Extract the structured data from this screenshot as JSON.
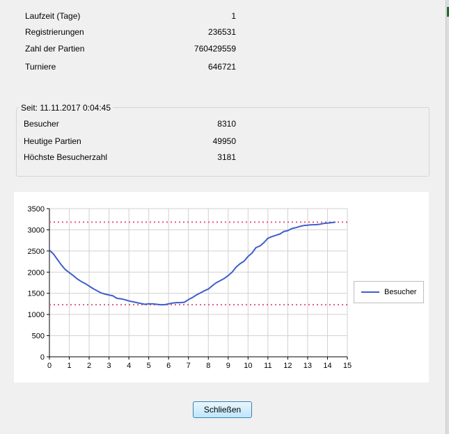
{
  "stats": [
    {
      "label": "Laufzeit (Tage)",
      "value": "1"
    },
    {
      "label": "Registrierungen",
      "value": "236531"
    },
    {
      "label": "Zahl der Partien",
      "value": "760429559"
    },
    {
      "label": "Turniere",
      "value": "646721"
    }
  ],
  "group": {
    "title": "Seit: 11.11.2017 0:04:45",
    "rows": [
      {
        "label": "Besucher",
        "value": "8310"
      },
      {
        "label": "Heutige Partien",
        "value": "49950"
      },
      {
        "label": "Höchste Besucherzahl",
        "value": "3181"
      }
    ]
  },
  "chart_data": {
    "type": "line",
    "xlim": [
      0,
      15
    ],
    "ylim": [
      0,
      3500
    ],
    "x_ticks": [
      "0",
      "1",
      "2",
      "3",
      "4",
      "5",
      "6",
      "7",
      "8",
      "9",
      "10",
      "11",
      "12",
      "13",
      "14",
      "15"
    ],
    "y_ticks": [
      "0",
      "500",
      "1000",
      "1500",
      "2000",
      "2500",
      "3000",
      "3500"
    ],
    "grid": true,
    "legend_position": "right",
    "series": [
      {
        "name": "Besucher",
        "color": "#3f5ecc",
        "x": [
          0,
          0.2,
          0.4,
          0.6,
          0.8,
          1.0,
          1.2,
          1.4,
          1.6,
          1.8,
          2.0,
          2.2,
          2.4,
          2.6,
          2.8,
          3.0,
          3.2,
          3.4,
          3.6,
          3.8,
          4.0,
          4.2,
          4.4,
          4.6,
          4.8,
          5.0,
          5.2,
          5.4,
          5.6,
          5.8,
          6.0,
          6.2,
          6.4,
          6.6,
          6.8,
          7.0,
          7.2,
          7.4,
          7.6,
          7.8,
          8.0,
          8.2,
          8.4,
          8.6,
          8.8,
          9.0,
          9.2,
          9.4,
          9.6,
          9.8,
          10.0,
          10.2,
          10.4,
          10.6,
          10.8,
          11.0,
          11.2,
          11.4,
          11.6,
          11.8,
          12.0,
          12.2,
          12.4,
          12.6,
          12.8,
          13.0,
          13.2,
          13.4,
          13.6,
          13.8,
          14.0,
          14.2,
          14.4
        ],
        "y": [
          2520,
          2430,
          2300,
          2170,
          2060,
          1990,
          1920,
          1840,
          1780,
          1730,
          1670,
          1610,
          1560,
          1510,
          1480,
          1460,
          1440,
          1380,
          1370,
          1350,
          1320,
          1300,
          1280,
          1260,
          1240,
          1250,
          1250,
          1240,
          1230,
          1230,
          1250,
          1270,
          1280,
          1280,
          1290,
          1350,
          1400,
          1460,
          1510,
          1560,
          1600,
          1680,
          1750,
          1800,
          1850,
          1920,
          2000,
          2120,
          2200,
          2260,
          2370,
          2450,
          2580,
          2620,
          2700,
          2800,
          2840,
          2870,
          2900,
          2960,
          2980,
          3030,
          3050,
          3080,
          3100,
          3110,
          3120,
          3120,
          3130,
          3150,
          3160,
          3170,
          3181
        ]
      }
    ],
    "reference_lines": [
      {
        "y": 3181,
        "color": "#e05a78",
        "style": "dotted"
      },
      {
        "y": 1230,
        "color": "#e05a78",
        "style": "dotted"
      }
    ]
  },
  "legend": {
    "label": "Besucher"
  },
  "buttons": {
    "close": "Schließen"
  }
}
